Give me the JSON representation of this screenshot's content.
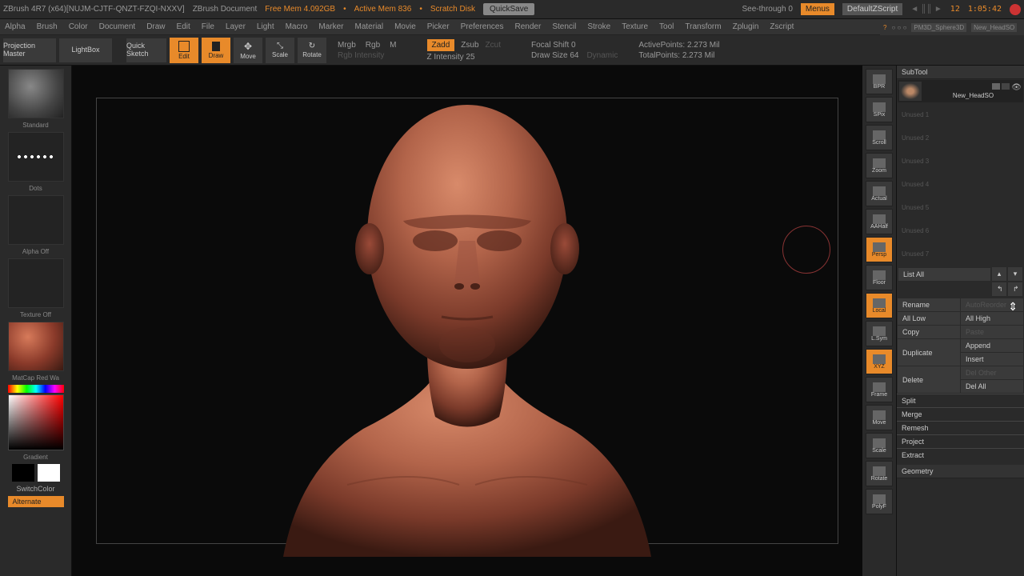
{
  "titleBar": {
    "appTitle": "ZBrush 4R7 (x64)[NUJM-CJTF-QNZT-FZQI-NXXV]",
    "docTitle": "ZBrush Document",
    "freeMem": "Free Mem 4.092GB",
    "activeMem": "Active Mem 836",
    "scratch": "Scratch Disk",
    "quickSave": "QuickSave",
    "seeThrough": "See-through   0",
    "menus": "Menus",
    "zscript": "DefaultZScript",
    "time": "1:05:42",
    "frame": "12"
  },
  "menuBar": [
    "Alpha",
    "Brush",
    "Color",
    "Document",
    "Draw",
    "Edit",
    "File",
    "Layer",
    "Light",
    "Macro",
    "Marker",
    "Material",
    "Movie",
    "Picker",
    "Preferences",
    "Render",
    "Stencil",
    "Stroke",
    "Texture",
    "Tool",
    "Transform",
    "Zplugin",
    "Zscript"
  ],
  "toolbar": {
    "projectionMaster": "Projection Master",
    "lightBox": "LightBox",
    "quickSketch": "Quick Sketch",
    "edit": "Edit",
    "draw": "Draw",
    "move": "Move",
    "scale": "Scale",
    "rotate": "Rotate",
    "mrgb": "Mrgb",
    "rgb": "Rgb",
    "m": "M",
    "rgbIntensity": "Rgb Intensity",
    "zadd": "Zadd",
    "zsub": "Zsub",
    "zcut": "Zcut",
    "zIntensity": "Z Intensity 25",
    "focalShift": "Focal Shift 0",
    "drawSize": "Draw Size 64",
    "dynamic": "Dynamic",
    "activePoints": "ActivePoints: 2.273 Mil",
    "totalPoints": "TotalPoints: 2.273 Mil"
  },
  "leftPanel": {
    "brush": "Standard",
    "stroke": "Dots",
    "alpha": "Alpha Off",
    "texture": "Texture Off",
    "material": "MatCap Red Wa",
    "gradient": "Gradient",
    "switchColor": "SwitchColor",
    "alternate": "Alternate"
  },
  "rightTools": [
    "BPR",
    "SPix",
    "Scroll",
    "Zoom",
    "Actual",
    "AAHalf",
    "Persp",
    "Floor",
    "Local",
    "L.Sym",
    "XYZ",
    "Frame",
    "Move",
    "Scale",
    "Rotate",
    "PolyF"
  ],
  "rightPanel": {
    "subToolHeader": "SubTool",
    "activeSubtool": "New_HeadSO",
    "unused": [
      "Unused 1",
      "Unused 2",
      "Unused 3",
      "Unused 4",
      "Unused 5",
      "Unused 6",
      "Unused 7"
    ],
    "listAll": "List All",
    "actions": {
      "rename": "Rename",
      "autoReorder": "AutoReorder",
      "allLow": "All Low",
      "allHigh": "All High",
      "copy": "Copy",
      "paste": "Paste",
      "duplicate": "Duplicate",
      "append": "Append",
      "insert": "Insert",
      "delete": "Delete",
      "delOther": "Del Other",
      "delAll": "Del All"
    },
    "sections": [
      "Split",
      "Merge",
      "Remesh",
      "Project",
      "Extract"
    ],
    "geometry": "Geometry",
    "toolTabs": [
      "PM3D_Sphere3D",
      "New_HeadSO"
    ]
  }
}
